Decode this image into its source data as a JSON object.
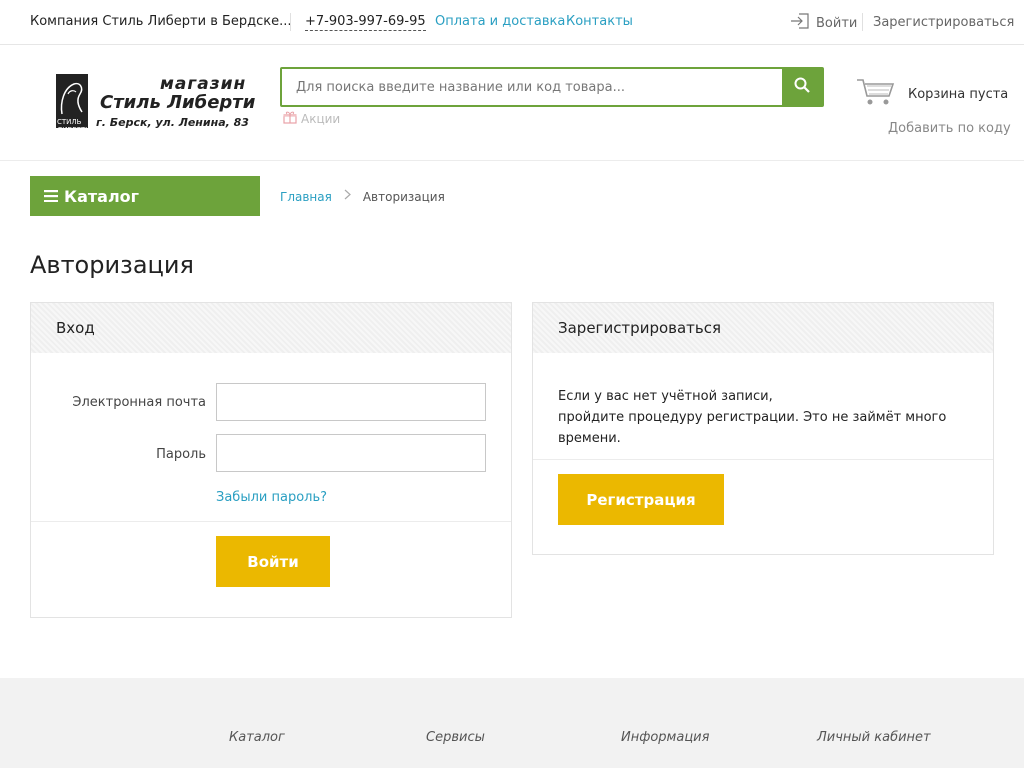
{
  "topbar": {
    "company": "Компания Стиль Либерти в Бердске...",
    "phone": "+7-903-997-69-95",
    "links": [
      "Оплата и доставка",
      "Контакты"
    ],
    "login": "Войти",
    "register": "Зарегистрироваться"
  },
  "header": {
    "logo": {
      "line1": "магазин",
      "line2": "Стиль Либерти",
      "line3": "г. Берск, ул. Ленина, 83",
      "badge": "СТИЛЬ ЛИБЕРТИ"
    },
    "search_placeholder": "Для поиска введите название или код товара...",
    "promo": "Акции",
    "cart": "Корзина пуста",
    "add_by_code": "Добавить по коду"
  },
  "nav": {
    "catalog": "Каталог",
    "breadcrumb": {
      "home": "Главная",
      "current": "Авторизация"
    }
  },
  "page_title": "Авторизация",
  "login_panel": {
    "title": "Вход",
    "email_label": "Электронная почта",
    "password_label": "Пароль",
    "forgot": "Забыли пароль?",
    "submit": "Войти"
  },
  "reg_panel": {
    "title": "Зарегистрироваться",
    "text_line1": "Если у вас нет учётной записи,",
    "text_line2": "пройдите процедуру регистрации. Это не займёт много времени.",
    "button": "Регистрация"
  },
  "footer": {
    "columns": [
      "Каталог",
      "Сервисы",
      "Информация",
      "Личный кабинет"
    ]
  },
  "colors": {
    "green": "#6da33b",
    "yellow": "#ebb800",
    "link_blue": "#2a9fc2"
  }
}
